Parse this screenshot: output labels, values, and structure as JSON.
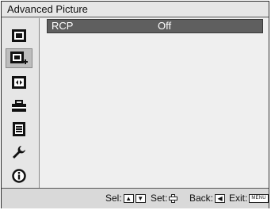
{
  "title": "Advanced Picture",
  "sidebar": {
    "items": [
      {
        "icon": "picture-icon"
      },
      {
        "icon": "advanced-picture-icon"
      },
      {
        "icon": "screen-icon"
      },
      {
        "icon": "setup-icon"
      },
      {
        "icon": "menu-icon"
      },
      {
        "icon": "installation-icon"
      },
      {
        "icon": "information-icon"
      }
    ],
    "selected_index": 1
  },
  "content": {
    "rows": [
      {
        "label": "RCP",
        "value": "Off"
      }
    ]
  },
  "footer": {
    "sel_label": "Sel:",
    "set_label": "Set:",
    "back_label": "Back:",
    "exit_label": "Exit:",
    "up_key": "▲",
    "down_key": "▼",
    "back_key": "◀",
    "menu_key": "MENU"
  },
  "colors": {
    "highlight_row": "#5f5f5f",
    "selected_sidebar": "#bdbdbd"
  }
}
